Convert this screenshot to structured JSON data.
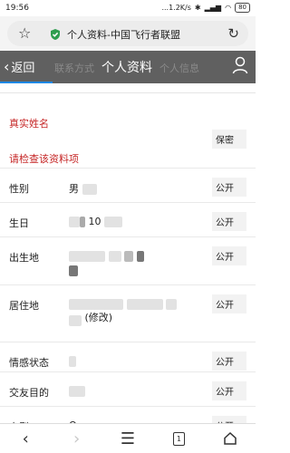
{
  "status_bar": {
    "time": "19:56",
    "network_speed": "...1.2K/s",
    "battery": "80"
  },
  "browser": {
    "page_title": "个人资料-中国飞行者联盟"
  },
  "app_header": {
    "back_label": "返回",
    "tab_contact": "联系方式",
    "tab_personal": "个人信息",
    "title": "个人资料"
  },
  "profile": {
    "real_name_label": "真实姓名",
    "real_name_privacy": "保密",
    "error_message": "请检查该资料项",
    "rows": [
      {
        "label": "性别",
        "value": "男",
        "privacy": "公开"
      },
      {
        "label": "生日",
        "value": "10",
        "privacy": "公开"
      },
      {
        "label": "出生地",
        "value": "",
        "privacy": "公开"
      },
      {
        "label": "居住地",
        "value": "(修改)",
        "privacy": "公开"
      },
      {
        "label": "情感状态",
        "value": "",
        "privacy": "公开"
      },
      {
        "label": "交友目的",
        "value": "",
        "privacy": "公开"
      },
      {
        "label": "血型",
        "value": "O",
        "privacy": "公开"
      }
    ]
  },
  "bottom_nav": {
    "tab_count": "1"
  }
}
